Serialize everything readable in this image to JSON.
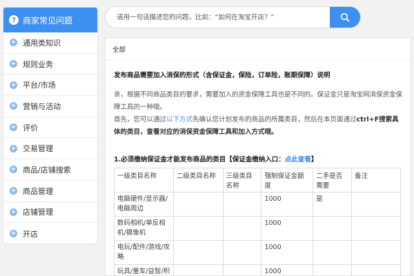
{
  "sidebar": {
    "title": "商家常见问题",
    "items": [
      {
        "label": "通用类知识"
      },
      {
        "label": "规则业务"
      },
      {
        "label": "平台/市场"
      },
      {
        "label": "营销与活动"
      },
      {
        "label": "评价"
      },
      {
        "label": "交易管理"
      },
      {
        "label": "商品/店铺搜索"
      },
      {
        "label": "商品管理"
      },
      {
        "label": "店铺管理"
      },
      {
        "label": "开店"
      }
    ]
  },
  "search": {
    "placeholder": "请用一句话描述您的问题，比如：“如何在淘宝开店？”"
  },
  "main": {
    "breadcrumb": "全部",
    "title": "发布商品需要加入消保的形式（含保证金，保险，订单险，账期保障）说明",
    "para1": "亲，根据不同商品类目的要求，需要加入的资金保障工具也是不同的。保证金只是淘宝网消保资金保障工具的一种哦。",
    "para2_a": "首先，您可以通过",
    "para2_link": "以下方式",
    "para2_b": "先确认您计划发布的商品的所属类目，然后在本页面通过",
    "para2_bold": "ctrl+F搜索具体的类目，查看对应的消保资金保障工具和加入方式哦。",
    "section_heading_a": "1.必须缴纳保证金才能发布商品的类目【保证金缴纳入口：",
    "section_heading_link": "点此查看",
    "section_heading_b": "】",
    "table": {
      "headers": [
        "一级类目名称",
        "二级类目名称",
        "三级类目名称",
        "强制保证金额度",
        "二手是否需要",
        "备注"
      ],
      "rows": [
        [
          "电脑硬件/显示器/电脑周边",
          "",
          "",
          "1000",
          "是",
          ""
        ],
        [
          "数码相机/单反相机/摄像机",
          "",
          "",
          "1000",
          "",
          ""
        ],
        [
          "电玩/配件/游戏/攻略",
          "",
          "",
          "1000",
          "",
          ""
        ],
        [
          "玩具/童车/益智/积木/模型",
          "",
          "",
          "1000",
          "",
          ""
        ]
      ]
    }
  },
  "colors": {
    "accent": "#3d8ff0",
    "plus_icon": "#8db6e8",
    "background": "#f2f2f2"
  }
}
